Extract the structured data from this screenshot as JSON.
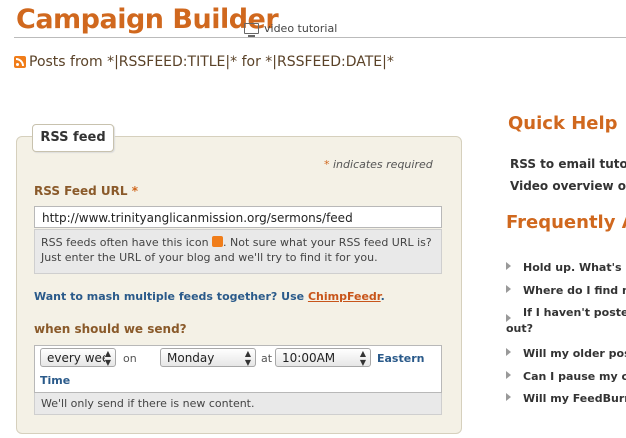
{
  "header": {
    "title": "Campaign Builder",
    "video_tutorial": "video tutorial",
    "subhead": "Posts from *|RSSFEED:TITLE|* for *|RSSFEED:DATE|*"
  },
  "form": {
    "tab": "RSS feed",
    "required_note": "indicates required",
    "url_label": "RSS Feed URL",
    "url_value": "http://www.trinityanglicanmission.org/sermons/feed",
    "hint_a": "RSS feeds often have this icon",
    "hint_b": ". Not sure what your RSS feed URL is? Just enter the URL of your blog and we'll try to find it for you.",
    "mash_text": "Want to mash multiple feeds together? Use",
    "mash_link": "ChimpFeedr",
    "mash_end": ".",
    "send_label": "when should we send?",
    "frequency": "every week",
    "on_word": "on",
    "day": "Monday",
    "at_word": "at",
    "time": "10:00AM",
    "timezone_a": "Eastern",
    "timezone_b": "Time",
    "only_new_note": "We'll only send if there is new content."
  },
  "sidebar": {
    "quick_help": "Quick Help",
    "links": [
      "RSS to email tutorial",
      "Video overview of RSS"
    ],
    "faq_title": "Frequently Asked Questions",
    "faq": [
      "Hold up. What's RSS?",
      "Where do I find my RSS feed?",
      "If I haven't posted anything new, will it send out?",
      "Will my older posts be sent?",
      "Can I pause my campaign?",
      "Will my FeedBurner feed work?"
    ]
  },
  "colors": {
    "accent": "#d0681e",
    "link": "#2a5a8a",
    "panel": "#f4f1e6"
  }
}
